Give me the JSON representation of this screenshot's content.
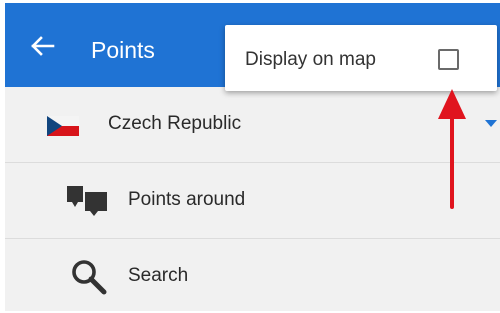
{
  "appbar": {
    "title": "Points",
    "back_icon": "arrow-left-icon",
    "color": "#1f73d4"
  },
  "popup_menu": {
    "item_label": "Display on map",
    "checked": false
  },
  "list": {
    "items": [
      {
        "label": "Czech Republic",
        "icon": "czech-flag-icon",
        "has_dropdown": true
      },
      {
        "label": "Points around",
        "icon": "points-around-icon"
      },
      {
        "label": "Search",
        "icon": "search-icon"
      }
    ]
  },
  "annotation": {
    "type": "red-arrow-pointing-up",
    "color": "#e0141e"
  }
}
